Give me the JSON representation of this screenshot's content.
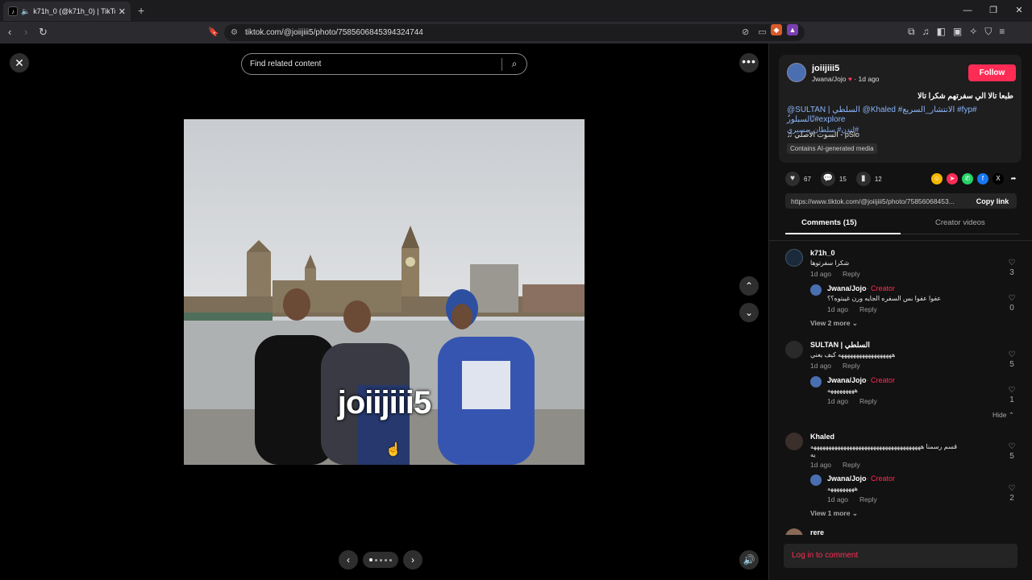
{
  "browser": {
    "tab_title": "k71h_0 (@k71h_0) | TikTok",
    "tab_favicon": "tiktok-icon",
    "url": "tiktok.com/@joiijiii5/photo/7585606845394324744",
    "window_controls": [
      "minimize",
      "restore",
      "close"
    ]
  },
  "viewer": {
    "search_placeholder": "Find related content",
    "overlay_text": "joiijiii5",
    "page_count": 5,
    "current_page": 1
  },
  "post": {
    "username": "joiijiii5",
    "display_name": "Jwana/Jojo",
    "time": "1d ago",
    "follow_label": "Follow",
    "caption": "طبعا تالا الي سفرتهم شكرا تالا",
    "tags_line1": "@SULTAN | السلطي @Khaled #الانتشار_السريع #fyp# ٌتّالسبلور#explore",
    "tags_line2": "لندن# سلطان_مسيري#",
    "sound": "السوت الأصلي - pSlo",
    "ai_badge": "Contains AI-generated media",
    "likes": "67",
    "comments_count": "15",
    "saves": "12",
    "share_link": "https://www.tiktok.com/@joiijiii5/photo/75856068453...",
    "copy_label": "Copy link",
    "tab_comments": "Comments (15)",
    "tab_creator": "Creator videos",
    "login_label": "Log in to comment"
  },
  "comments": [
    {
      "name": "k71h_0",
      "text": "شكرا سفرتوها",
      "time": "1d ago",
      "reply": "Reply",
      "likes": "3"
    },
    {
      "name": "Jwana/Jojo",
      "creator": "· Creator",
      "text": "عفوا عفوا بس السفره الجايه ورن غيبتوه؟؟",
      "time": "1d ago",
      "reply": "Reply",
      "likes": "0"
    },
    {
      "viewmore": "View 2 more"
    },
    {
      "name": "SULTAN | السلطي",
      "text": "ههههههههههههههههههه كيف يعني",
      "time": "1d ago",
      "reply": "Reply",
      "likes": "5"
    },
    {
      "name": "Jwana/Jojo",
      "creator": "· Creator",
      "text": "هههههههههه",
      "time": "1d ago",
      "reply": "Reply",
      "likes": "1"
    },
    {
      "hide": "Hide"
    },
    {
      "name": "Khaled",
      "text": "قسم رسمنا هههههههههههههههههههههههههههههههههههههه",
      "text2": "يه",
      "time": "1d ago",
      "reply": "Reply",
      "likes": "5"
    },
    {
      "name": "Jwana/Jojo",
      "creator": "· Creator",
      "text": "هههههههههه",
      "time": "1d ago",
      "reply": "Reply",
      "likes": "2"
    },
    {
      "viewmore": "View 1 more"
    },
    {
      "name": "rere"
    }
  ]
}
